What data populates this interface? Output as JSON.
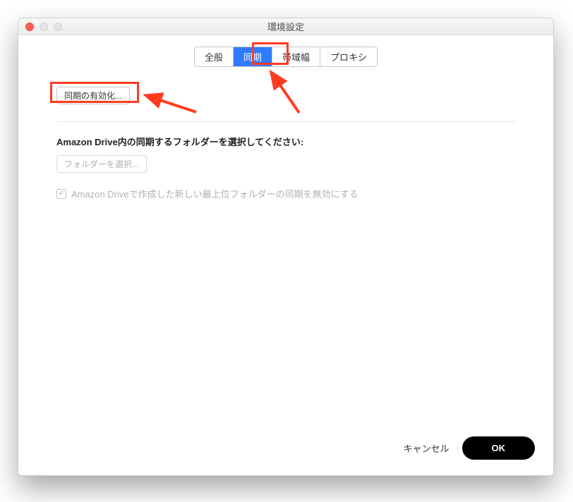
{
  "window": {
    "title": "環境設定"
  },
  "tabs": {
    "general": "全般",
    "sync": "同期",
    "bandwidth": "帯域幅",
    "proxy": "プロキシ",
    "active": "sync"
  },
  "main": {
    "enable_sync": "同期の有効化...",
    "select_folder_label": "Amazon Drive内の同期するフォルダーを選択してください:",
    "select_folder_button": "フォルダーを選択...",
    "checkbox_label": "Amazon Driveで作成した新しい最上位フォルダーの同期を無効にする"
  },
  "footer": {
    "cancel": "キャンセル",
    "ok": "OK"
  },
  "annotations": {
    "highlight_color": "#ff3b1f"
  }
}
